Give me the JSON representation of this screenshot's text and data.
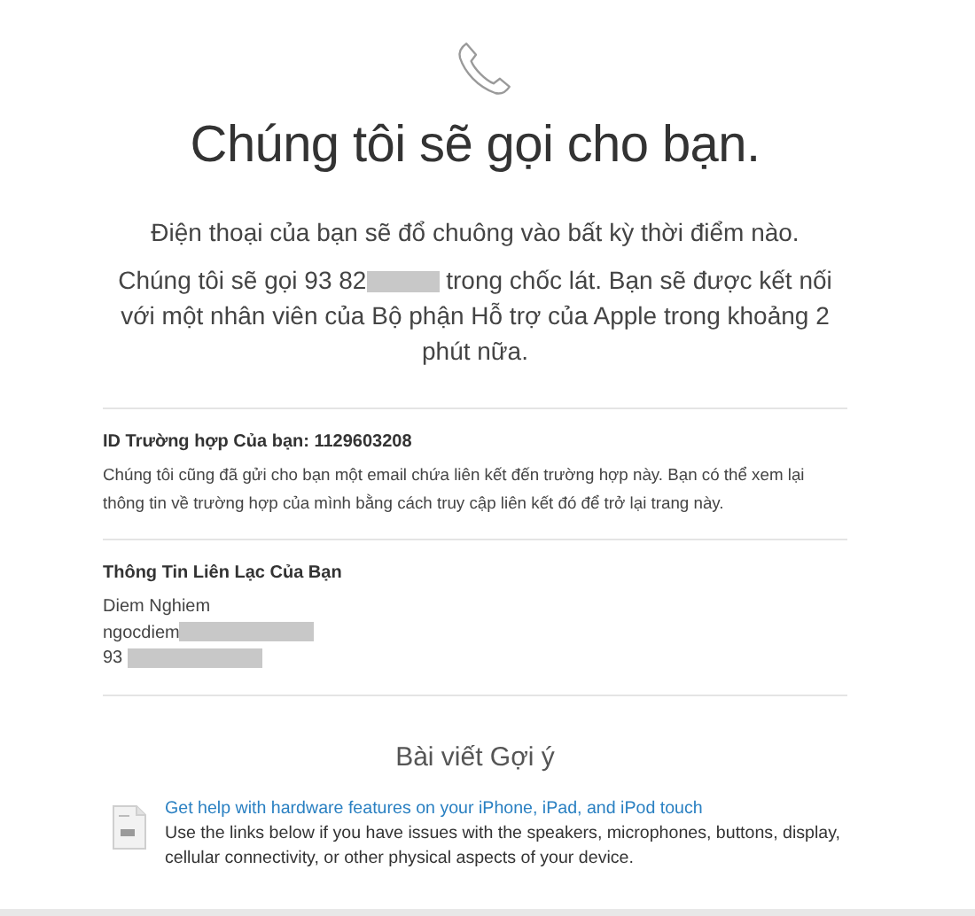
{
  "header": {
    "title": "Chúng tôi sẽ gọi cho bạn."
  },
  "intro": {
    "notice": "Điện thoại của bạn sẽ đổ chuông vào bất kỳ thời điểm nào.",
    "call_message": [
      {
        "kind": "text",
        "text": "Chúng tôi sẽ gọi 93 82"
      },
      {
        "kind": "redacted"
      },
      {
        "kind": "text",
        "text": " trong chốc lát. Bạn sẽ được kết nối với một nhân viên của Bộ phận Hỗ trợ của Apple trong khoảng 2 phút nữa."
      }
    ]
  },
  "case": {
    "id_label": "ID Trường hợp Của bạn: 1129603208",
    "description": "Chúng tôi cũng đã gửi cho bạn một email chứa liên kết đến trường hợp này. Bạn có thể xem lại thông tin về trường hợp của mình bằng cách truy cập liên kết đó để trở lại trang này."
  },
  "contact": {
    "heading": "Thông Tin Liên Lạc Của Bạn",
    "lines": [
      [
        {
          "kind": "text",
          "text": "Diem Nghiem"
        }
      ],
      [
        {
          "kind": "text",
          "text": "ngocdiem"
        },
        {
          "kind": "redacted"
        }
      ],
      [
        {
          "kind": "text",
          "text": "93 "
        },
        {
          "kind": "redacted"
        }
      ]
    ]
  },
  "articles": {
    "heading": "Bài viết Gợi ý",
    "items": [
      {
        "title": "Get help with hardware features on your iPhone, iPad, and iPod touch",
        "description": "Use the links below if you have issues with the speakers, microphones, buttons, display, cellular connectivity, or other physical aspects of your device."
      }
    ]
  }
}
